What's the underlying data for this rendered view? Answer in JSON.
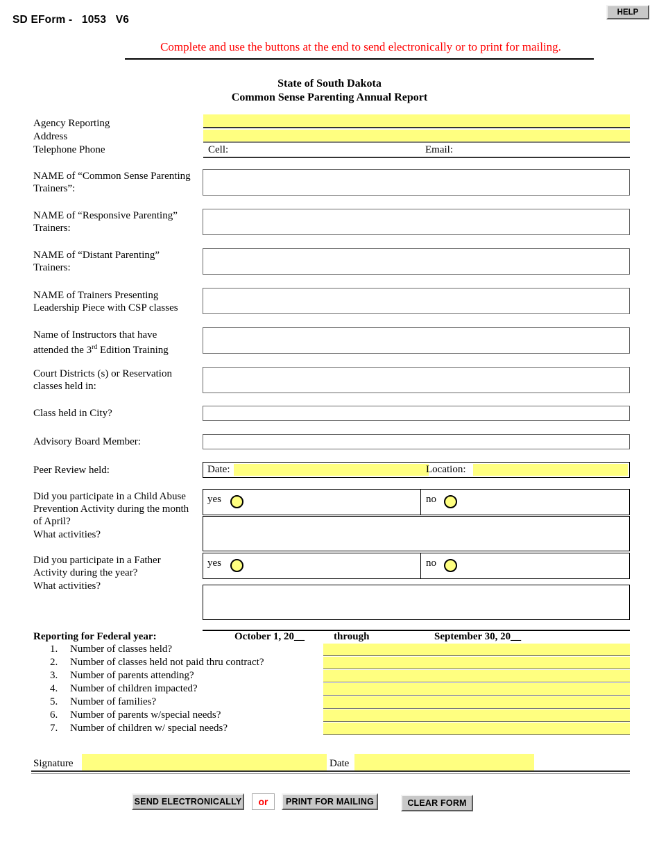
{
  "header": {
    "form_id": "SD EForm -   1053   V6",
    "help_label": "HELP",
    "instruction": "Complete and use the buttons at the end to send electronically or to print for mailing."
  },
  "title": {
    "line1": "State of South Dakota",
    "line2": "Common Sense Parenting Annual Report"
  },
  "contact": {
    "agency_label": "Agency Reporting",
    "address_label": "Address",
    "telephone_label": "Telephone Phone",
    "cell_label": "Cell:",
    "email_label": "Email:",
    "agency_value": "",
    "address_value": "",
    "telephone_value": "",
    "cell_value": "",
    "email_value": ""
  },
  "fields": [
    {
      "label_line1": "NAME of “Common Sense Parenting",
      "label_line2": "Trainers”:",
      "value": ""
    },
    {
      "label_line1": "NAME of “Responsive Parenting”",
      "label_line2": "Trainers:",
      "value": ""
    },
    {
      "label_line1": "NAME of “Distant Parenting”",
      "label_line2": "Trainers:",
      "value": ""
    },
    {
      "label_line1": "NAME of Trainers Presenting",
      "label_line2": "Leadership Piece with CSP classes",
      "value": ""
    },
    {
      "label_line1": "Name of Instructors that have",
      "label_line2": "attended the 3rd Edition Training",
      "value": ""
    },
    {
      "label_line1": "Court Districts (s) or Reservation",
      "label_line2": "classes held in:",
      "value": ""
    }
  ],
  "single_fields": [
    {
      "label": "Class held in City?",
      "value": ""
    },
    {
      "label": "Advisory Board Member:",
      "value": ""
    }
  ],
  "peer_review": {
    "label": "Peer Review held:",
    "date_label": "Date:",
    "date_value": "",
    "location_label": "Location:",
    "location_value": ""
  },
  "questions": [
    {
      "label_lines": [
        "Did you participate in a Child Abuse",
        "Prevention Activity during the month",
        "of April?",
        "What activities?"
      ],
      "yes_label": "yes",
      "no_label": "no",
      "answer": "",
      "activities_value": ""
    },
    {
      "label_lines": [
        "Did you participate in a Father",
        "Activity during the year?",
        "What activities?"
      ],
      "yes_label": "yes",
      "no_label": "no",
      "answer": "",
      "activities_value": ""
    }
  ],
  "reporting": {
    "label": "Reporting for Federal year:",
    "start_label": "October 1, 20__",
    "through_label": "through",
    "end_label": "September 30, 20__",
    "items": [
      {
        "num": "1.",
        "text": "Number of classes held?",
        "value": ""
      },
      {
        "num": "2.",
        "text": "Number of classes held not paid thru contract?",
        "value": ""
      },
      {
        "num": "3.",
        "text": "Number of parents attending?",
        "value": ""
      },
      {
        "num": "4.",
        "text": "Number of children impacted?",
        "value": ""
      },
      {
        "num": "5.",
        "text": "Number of families?",
        "value": ""
      },
      {
        "num": "6.",
        "text": "Number of parents w/special needs?",
        "value": ""
      },
      {
        "num": "7.",
        "text": "Number of children w/ special needs?",
        "value": ""
      }
    ]
  },
  "signature": {
    "signature_label": "Signature",
    "signature_value": "",
    "date_label": "Date",
    "date_value": ""
  },
  "actions": {
    "send_label": "SEND ELECTRONICALLY",
    "or_label": "or",
    "print_label": "PRINT FOR MAILING",
    "clear_label": "CLEAR FORM"
  },
  "colors": {
    "field_yellow": "#ffff80",
    "instruction_red": "#ff0000",
    "button_face": "#c8c8c8"
  }
}
